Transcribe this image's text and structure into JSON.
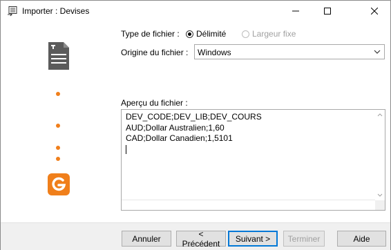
{
  "window": {
    "title": "Importer : Devises"
  },
  "form": {
    "file_type_label": "Type de fichier :",
    "radio_delimited": "Délimité",
    "radio_fixed": "Largeur fixe",
    "origin_label": "Origine du fichier :",
    "origin_value": "Windows",
    "preview_label": "Aperçu du fichier :",
    "preview_lines": [
      "DEV_CODE;DEV_LIB;DEV_COURS",
      "AUD;Dollar Australien;1,60",
      "CAD;Dollar Canadien;1,5101"
    ]
  },
  "buttons": {
    "cancel": "Annuler",
    "previous": "< Précédent",
    "next": "Suivant >",
    "finish": "Terminer",
    "help": "Aide"
  },
  "colors": {
    "accent": "#f07f1b",
    "doc_icon": "#5b5b5b",
    "default_btn_border": "#0078d7"
  }
}
